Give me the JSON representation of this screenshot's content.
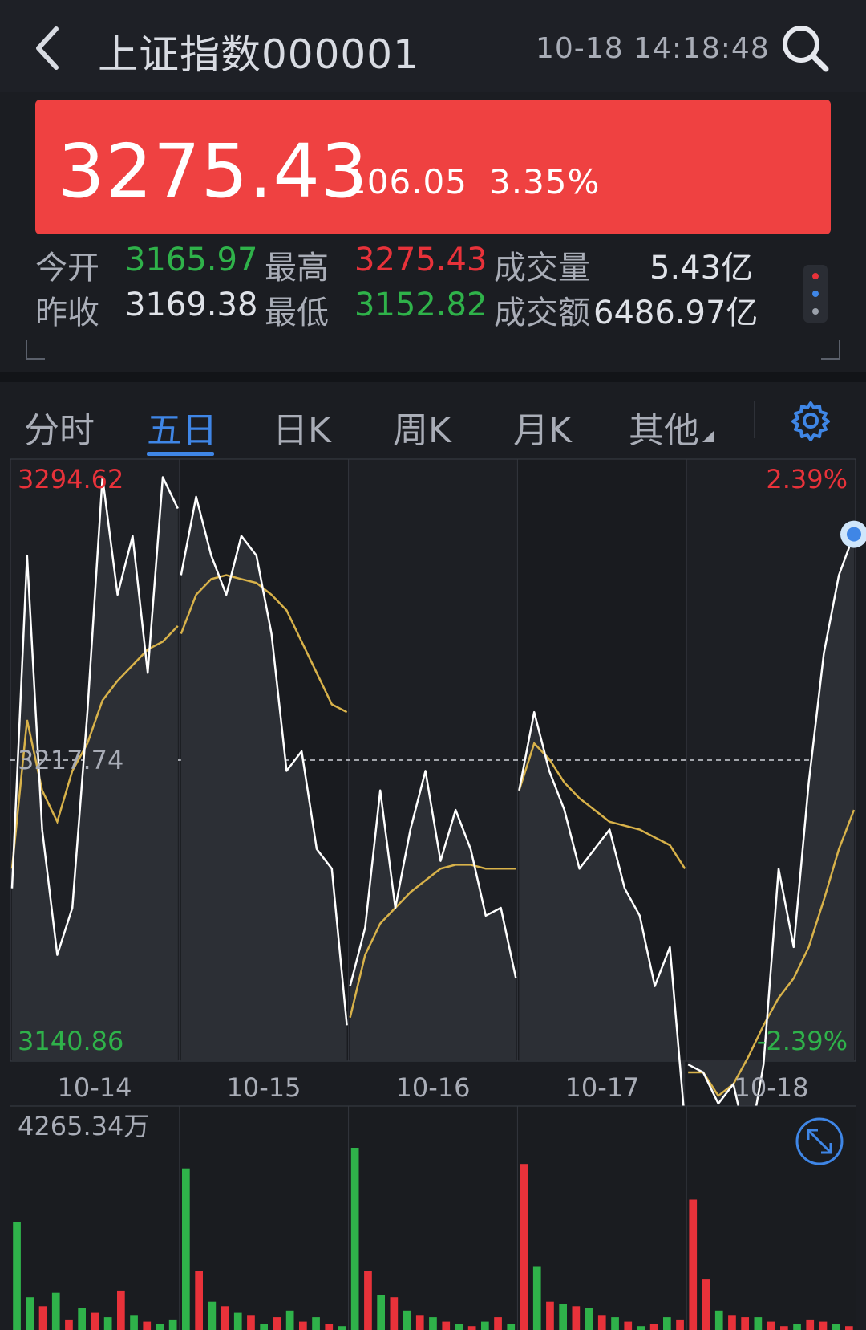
{
  "header": {
    "title": "上证指数000001",
    "time": "10-18 14:18:48"
  },
  "quote": {
    "price": "3275.43",
    "change": "106.05",
    "change_pct": "3.35%"
  },
  "stats": {
    "open_label": "今开",
    "open_value": "3165.97",
    "high_label": "最高",
    "high_value": "3275.43",
    "volume_label": "成交量",
    "volume_value": "5.43亿",
    "prev_close_label": "昨收",
    "prev_close_value": "3169.38",
    "low_label": "最低",
    "low_value": "3152.82",
    "amount_label": "成交额",
    "amount_value": "6486.97亿"
  },
  "tabs": [
    {
      "label": "分时",
      "active": false
    },
    {
      "label": "五日",
      "active": true
    },
    {
      "label": "日K",
      "active": false
    },
    {
      "label": "周K",
      "active": false
    },
    {
      "label": "月K",
      "active": false
    },
    {
      "label": "其他",
      "active": false
    }
  ],
  "colors": {
    "up": "#e8323a",
    "down": "#2fb24a",
    "accent": "#3f86e6",
    "price_box": "#ef4141",
    "avg_line": "#d8b24a"
  },
  "icons": [
    "back-icon",
    "search-icon",
    "more-dots-icon",
    "gear-icon",
    "expand-icon",
    "dropdown-caret-icon"
  ],
  "chart_data": [
    {
      "type": "line",
      "x_labels": [
        "10-14",
        "10-15",
        "10-16",
        "10-17",
        "10-18"
      ],
      "y_max_label": "3294.62",
      "y_mid_label": "3217.74",
      "y_min_label": "3140.86",
      "pct_max_label": "2.39%",
      "pct_min_label": "-2.39%",
      "ylim": [
        3140.86,
        3294.62
      ],
      "reference_line": 3217.74,
      "series": [
        {
          "values": [
            [
              3185,
              3270,
              3200,
              3168,
              3180,
              3230,
              3290,
              3260,
              3275,
              3240,
              3290,
              3282
            ],
            [
              3265,
              3285,
              3270,
              3260,
              3275,
              3270,
              3250,
              3215,
              3220,
              3195,
              3190,
              3150
            ],
            [
              3160,
              3175,
              3210,
              3180,
              3200,
              3215,
              3192,
              3205,
              3195,
              3178,
              3180,
              3162
            ],
            [
              3210,
              3230,
              3215,
              3205,
              3190,
              3195,
              3200,
              3185,
              3178,
              3160,
              3170,
              3125
            ],
            [
              3140,
              3138,
              3130,
              3135,
              3118,
              3140,
              3190,
              3170,
              3212,
              3245,
              3265,
              3275.43
            ]
          ]
        },
        {
          "values": [
            [
              3190,
              3228,
              3210,
              3202,
              3215,
              3222,
              3233,
              3238,
              3242,
              3246,
              3248,
              3252
            ],
            [
              3250,
              3260,
              3264,
              3265,
              3264,
              3263,
              3260,
              3256,
              3248,
              3240,
              3232,
              3230
            ],
            [
              3152,
              3168,
              3176,
              3180,
              3184,
              3187,
              3190,
              3191,
              3191,
              3190,
              3190,
              3190
            ],
            [
              3210,
              3222,
              3218,
              3212,
              3208,
              3205,
              3202,
              3201,
              3200,
              3198,
              3196,
              3190
            ],
            [
              3138,
              3138,
              3132,
              3135,
              3142,
              3150,
              3157,
              3162,
              3170,
              3182,
              3195,
              3205
            ]
          ]
        }
      ]
    },
    {
      "type": "bar",
      "y_max_label": "4265.34万",
      "ylim": [
        0,
        4265.34
      ],
      "values": [
        [
          2600,
          900,
          700,
          1000,
          400,
          650,
          550,
          450,
          1050,
          500,
          350,
          300,
          400
        ],
        [
          3800,
          1500,
          800,
          700,
          550,
          500,
          300,
          450,
          600,
          350,
          450,
          300,
          250
        ],
        [
          4265.34,
          1500,
          950,
          900,
          600,
          500,
          450,
          350,
          300,
          250,
          350,
          450,
          300
        ],
        [
          3900,
          1600,
          800,
          750,
          700,
          650,
          500,
          450,
          350,
          250,
          300,
          450,
          400
        ],
        [
          3100,
          1300,
          600,
          500,
          450,
          450,
          350,
          250,
          300,
          400,
          350,
          300,
          250
        ]
      ],
      "colors": [
        [
          "down",
          "down",
          "up",
          "down",
          "up",
          "down",
          "up",
          "down",
          "up",
          "down",
          "up",
          "down",
          "down"
        ],
        [
          "down",
          "up",
          "down",
          "up",
          "down",
          "up",
          "down",
          "up",
          "down",
          "up",
          "down",
          "up",
          "down"
        ],
        [
          "down",
          "up",
          "down",
          "up",
          "down",
          "up",
          "down",
          "up",
          "down",
          "up",
          "down",
          "up",
          "down"
        ],
        [
          "up",
          "down",
          "up",
          "down",
          "up",
          "down",
          "up",
          "down",
          "up",
          "down",
          "up",
          "down",
          "up"
        ],
        [
          "up",
          "up",
          "down",
          "up",
          "up",
          "down",
          "up",
          "up",
          "down",
          "up",
          "up",
          "down",
          "up"
        ]
      ]
    }
  ]
}
